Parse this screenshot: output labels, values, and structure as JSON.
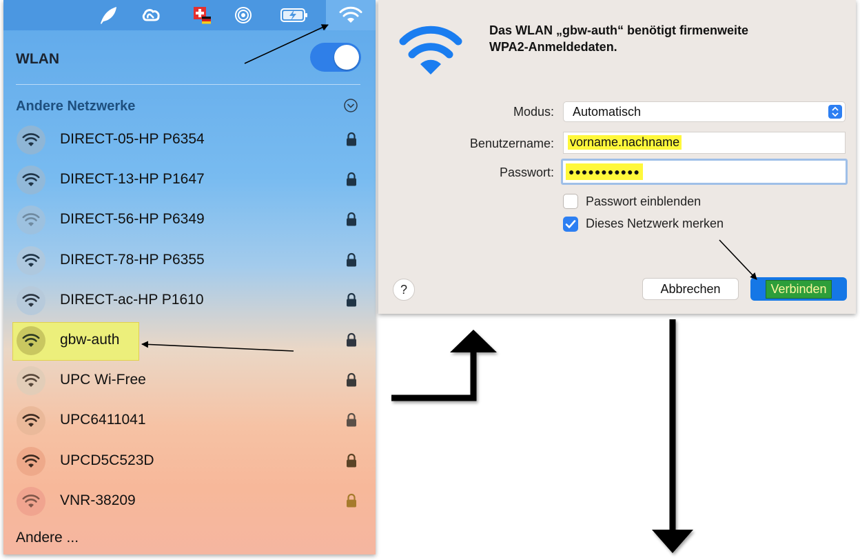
{
  "menubar": {
    "icons": [
      "feather-icon",
      "creative-cloud-icon",
      "swiss-german-flag-icon",
      "airdrop-icon",
      "battery-icon",
      "wifi-icon"
    ]
  },
  "wlan_menu": {
    "title": "WLAN",
    "toggle_on": true,
    "section_title": "Andere Netzwerke",
    "networks": [
      {
        "name": "DIRECT-05-HP P6354",
        "circle": "#8fb6d6",
        "wifi": "#1f3446",
        "lock": "#1f3446"
      },
      {
        "name": "DIRECT-13-HP P1647",
        "circle": "#92b9d9",
        "wifi": "#1f3446",
        "lock": "#1f3446"
      },
      {
        "name": "DIRECT-56-HP P6349",
        "circle": "#9dc1df",
        "wifi": "#6f8aa0",
        "lock": "#1f3446"
      },
      {
        "name": "DIRECT-78-HP P6355",
        "circle": "#aec8de",
        "wifi": "#1f3446",
        "lock": "#1f3446"
      },
      {
        "name": "DIRECT-ac-HP P1610",
        "circle": "#b7cadb",
        "wifi": "#2a3440",
        "lock": "#1f3446"
      },
      {
        "name": "gbw-auth",
        "circle": "#c9c760",
        "wifi": "#2d3a22",
        "lock": "#2f3640"
      },
      {
        "name": "UPC Wi-Free",
        "circle": "#e2cdb8",
        "wifi": "#57473a",
        "lock": "#3a3a3a"
      },
      {
        "name": "UPC6411041",
        "circle": "#eab99a",
        "wifi": "#3c2a20",
        "lock": "#5a5048"
      },
      {
        "name": "UPCD5C523D",
        "circle": "#eea98a",
        "wifi": "#3c2a20",
        "lock": "#5a4326"
      },
      {
        "name": "VNR-38209",
        "circle": "#f0a48f",
        "wifi": "#80574a",
        "lock": "#a67b2c"
      }
    ],
    "other_label": "Andere ..."
  },
  "dialog": {
    "heading": "Das WLAN „gbw-auth“ benötigt firmenweite WPA2-Anmeldedaten.",
    "mode_label": "Modus:",
    "mode_value": "Automatisch",
    "user_label": "Benutzername:",
    "user_value": "vorname.nachname",
    "pass_label": "Passwort:",
    "pass_value": "●●●●●●●●●●●",
    "show_password_label": "Passwort einblenden",
    "show_password_checked": false,
    "remember_label": "Dieses Netzwerk merken",
    "remember_checked": true,
    "help_label": "?",
    "cancel_label": "Abbrechen",
    "connect_label": "Verbinden"
  },
  "colors": {
    "accent_blue": "#2d7ff2",
    "highlight_yellow": "#fff83b",
    "connect_green": "#2d9e3a",
    "dialog_bg": "#ede8e4",
    "menubar_blue": "#4b97e1"
  }
}
